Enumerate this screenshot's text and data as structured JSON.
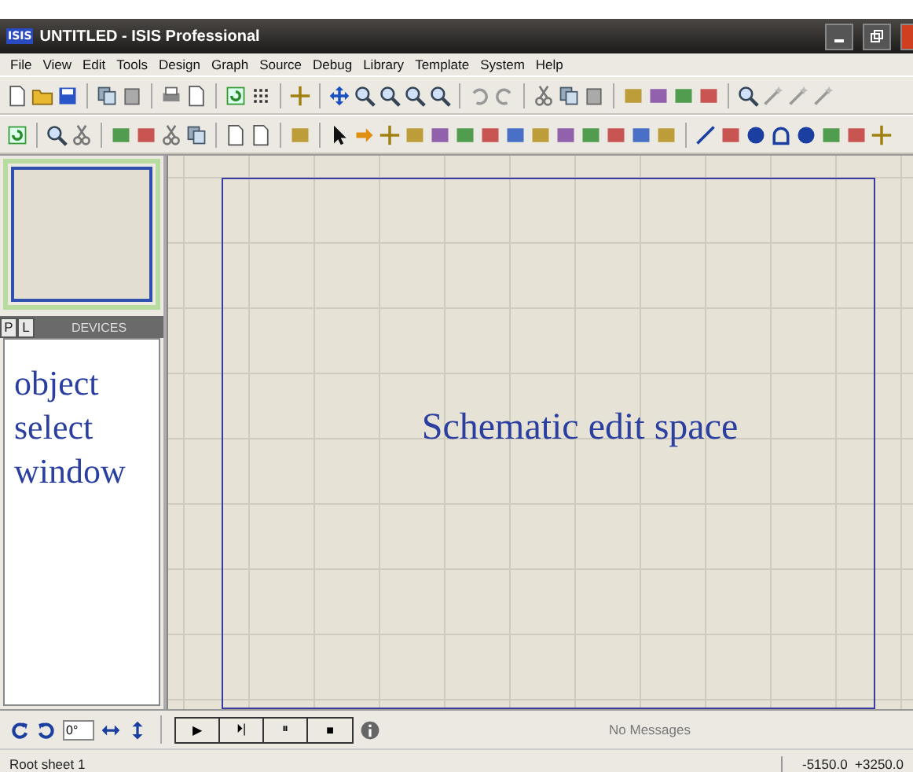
{
  "window": {
    "title": "UNTITLED - ISIS Professional",
    "app_badge": "ISIS"
  },
  "menu": [
    "File",
    "View",
    "Edit",
    "Tools",
    "Design",
    "Graph",
    "Source",
    "Debug",
    "Library",
    "Template",
    "System",
    "Help"
  ],
  "selector_tabs": [
    {
      "label": "P",
      "selected": false
    },
    {
      "label": "L",
      "selected": false
    }
  ],
  "selector_title": "DEVICES",
  "object_selector": {
    "caption": "object select window"
  },
  "canvas": {
    "caption": "Schematic edit space"
  },
  "rotation": {
    "value": "0°"
  },
  "transport": [
    "▶",
    "⏵|",
    "⏸",
    "■"
  ],
  "messages": "No Messages",
  "status_bar": {
    "sheet": "Root sheet 1",
    "coordinates": "-5150.0  +3250.0"
  }
}
